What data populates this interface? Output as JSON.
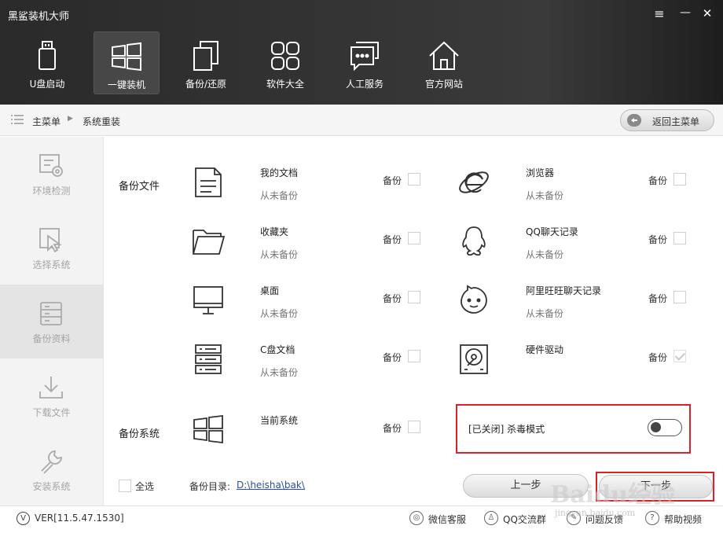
{
  "app": {
    "title": "黑鲨装机大师"
  },
  "window_controls": {
    "menu": "≡",
    "minimize": "—",
    "close": "✕"
  },
  "nav": [
    {
      "label": "U盘启动",
      "icon": "usb-drive-icon"
    },
    {
      "label": "一键装机",
      "icon": "windows-icon",
      "active": true
    },
    {
      "label": "备份/还原",
      "icon": "backup-restore-icon"
    },
    {
      "label": "软件大全",
      "icon": "apps-grid-icon"
    },
    {
      "label": "人工服务",
      "icon": "chat-bubble-icon"
    },
    {
      "label": "官方网站",
      "icon": "home-icon"
    }
  ],
  "breadcrumb": {
    "home": "主菜单",
    "current": "系统重装"
  },
  "back_button": "返回主菜单",
  "sidebar": [
    {
      "label": "环境检测",
      "icon": "environment-check-icon"
    },
    {
      "label": "选择系统",
      "icon": "select-system-icon"
    },
    {
      "label": "备份资料",
      "icon": "backup-data-icon",
      "active": true
    },
    {
      "label": "下载文件",
      "icon": "download-icon"
    },
    {
      "label": "安装系统",
      "icon": "install-wrench-icon"
    }
  ],
  "backup_files": {
    "section_title": "备份文件",
    "backup_label": "备份",
    "items": [
      {
        "name": "我的文档",
        "status": "从未备份",
        "icon": "document-icon",
        "checked": false
      },
      {
        "name": "浏览器",
        "status": "从未备份",
        "icon": "ie-browser-icon",
        "checked": false
      },
      {
        "name": "收藏夹",
        "status": "从未备份",
        "icon": "folder-icon",
        "checked": false
      },
      {
        "name": "QQ聊天记录",
        "status": "从未备份",
        "icon": "qq-penguin-icon",
        "checked": false
      },
      {
        "name": "桌面",
        "status": "从未备份",
        "icon": "monitor-icon",
        "checked": false
      },
      {
        "name": "阿里旺旺聊天记录",
        "status": "从未备份",
        "icon": "aliwangwang-icon",
        "checked": false
      },
      {
        "name": "C盘文档",
        "status": "从未备份",
        "icon": "server-drive-icon",
        "checked": false
      },
      {
        "name": "硬件驱动",
        "status": "",
        "icon": "hard-disk-icon",
        "checked": true
      }
    ]
  },
  "backup_system": {
    "section_title": "备份系统",
    "item": {
      "name": "当前系统",
      "backup_label": "备份",
      "icon": "windows-icon",
      "checked": false
    }
  },
  "antivirus": {
    "label": "[已关闭] 杀毒模式",
    "enabled": false
  },
  "select_all": "全选",
  "backup_dir": {
    "label": "备份目录:",
    "path": "D:\\heisha\\bak\\"
  },
  "buttons": {
    "prev": "上一步",
    "next": "下一步"
  },
  "footer": {
    "version": "VER[11.5.47.1530]",
    "links": [
      "微信客服",
      "QQ交流群",
      "问题反馈",
      "帮助视频"
    ]
  },
  "watermark": {
    "text": "Baidu经验",
    "url": "jingyan.baidu.com"
  },
  "colors": {
    "header_bg": "#2e2e2e",
    "highlight_box": "#d9222a",
    "link": "#2a4f9e"
  }
}
